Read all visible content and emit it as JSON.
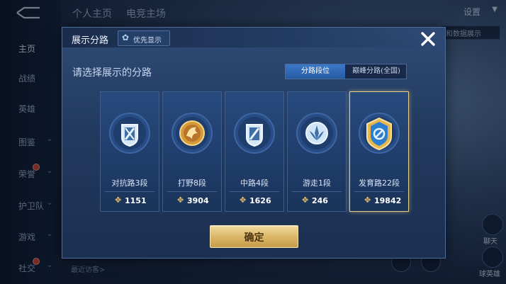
{
  "background": {
    "top_tabs": [
      "个人主页",
      "电竞主场"
    ],
    "settings_label": "设置",
    "bg_button_label": "和数据展示",
    "bottom_label": "最近访客>",
    "right_labels": [
      "聊天",
      "球英雄"
    ],
    "nav": [
      {
        "label": "主页",
        "active": true,
        "chevron": false,
        "dot": false
      },
      {
        "label": "战绩",
        "active": false,
        "chevron": false,
        "dot": false
      },
      {
        "label": "英雄",
        "active": false,
        "chevron": false,
        "dot": false
      },
      {
        "label": "图鉴",
        "active": false,
        "chevron": true,
        "dot": false
      },
      {
        "label": "荣誉",
        "active": false,
        "chevron": true,
        "dot": true
      },
      {
        "label": "护卫队",
        "active": false,
        "chevron": true,
        "dot": false
      },
      {
        "label": "游戏",
        "active": false,
        "chevron": true,
        "dot": false
      },
      {
        "label": "社交",
        "active": false,
        "chevron": true,
        "dot": true
      }
    ]
  },
  "dialog": {
    "title": "展示分路",
    "priority_label": "优先显示",
    "prompt": "请选择展示的分路",
    "toggle": {
      "option_a": "分路段位",
      "option_b": "巅峰分路(全国)",
      "selected": "option_a"
    },
    "confirm_label": "确定",
    "cards": [
      {
        "rank": "对抗路3段",
        "score": "1151",
        "medal": "clash-lane-medal-icon",
        "selected": false
      },
      {
        "rank": "打野8段",
        "score": "3904",
        "medal": "jungle-dragon-medal-icon",
        "selected": false
      },
      {
        "rank": "中路4段",
        "score": "1626",
        "medal": "mid-lane-medal-icon",
        "selected": false
      },
      {
        "rank": "游走1段",
        "score": "246",
        "medal": "roam-medal-icon",
        "selected": false
      },
      {
        "rank": "发育路22段",
        "score": "19842",
        "medal": "farm-lane-medal-icon",
        "selected": true
      }
    ]
  },
  "colors": {
    "accent_gold": "#e8cd8a",
    "toggle_active": "#3a79c9",
    "panel": "#2f4b76"
  }
}
